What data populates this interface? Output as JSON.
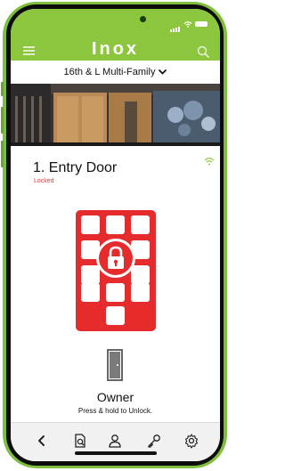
{
  "header": {
    "logo_text": "Inox"
  },
  "location": {
    "name": "16th & L Multi-Family"
  },
  "door": {
    "title": "1. Entry Door",
    "status": "Locked"
  },
  "user": {
    "role": "Owner",
    "hint": "Press & hold to Unlock."
  },
  "tabbar": {
    "items": [
      "back-icon",
      "search-doc-icon",
      "user-icon",
      "key-icon",
      "gear-icon"
    ]
  },
  "colors": {
    "brand": "#8cc63f",
    "accent": "#e52b2b",
    "status_locked": "#e53935"
  }
}
